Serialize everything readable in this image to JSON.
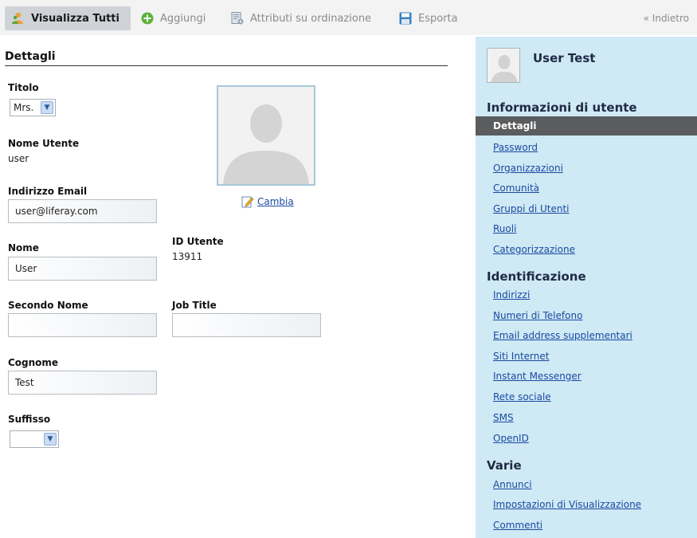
{
  "toolbar": {
    "view_all": "Visualizza Tutti",
    "add": "Aggiungi",
    "sort_attributes": "Attributi su ordinazione",
    "export": "Esporta",
    "back": "« Indietro"
  },
  "form": {
    "section_title": "Dettagli",
    "title_label": "Titolo",
    "title_value": "Mrs.",
    "username_label": "Nome Utente",
    "username_value": "user",
    "email_label": "Indirizzo Email",
    "email_value": "user@liferay.com",
    "first_name_label": "Nome",
    "first_name_value": "User",
    "middle_name_label": "Secondo Nome",
    "middle_name_value": "",
    "last_name_label": "Cognome",
    "last_name_value": "Test",
    "suffix_label": "Suffisso",
    "suffix_value": "",
    "user_id_label": "ID Utente",
    "user_id_value": "13911",
    "job_title_label": "Job Title",
    "job_title_value": "",
    "change_link": "Cambia"
  },
  "sidebar": {
    "user_name": "User Test",
    "sections": [
      {
        "heading": "Informazioni di utente",
        "items": [
          "Dettagli",
          "Password",
          "Organizzazioni",
          "Comunità",
          "Gruppi di Utenti",
          "Ruoli",
          "Categorizzazione"
        ]
      },
      {
        "heading": "Identificazione",
        "items": [
          "Indirizzi",
          "Numeri di Telefono",
          "Email address supplementari",
          "Siti Internet",
          "Instant Messenger",
          "Rete sociale",
          "SMS",
          "OpenID"
        ]
      },
      {
        "heading": "Varie",
        "items": [
          "Annunci",
          "Impostazioni di Visualizzazione",
          "Commenti"
        ]
      }
    ],
    "selected_item": "Dettagli"
  },
  "colors": {
    "sidebar_bg": "#cfe9f5",
    "selected_bg": "#5a5c5e",
    "link": "#1a4aa0",
    "toolbar_active": "#cfd3d8"
  }
}
